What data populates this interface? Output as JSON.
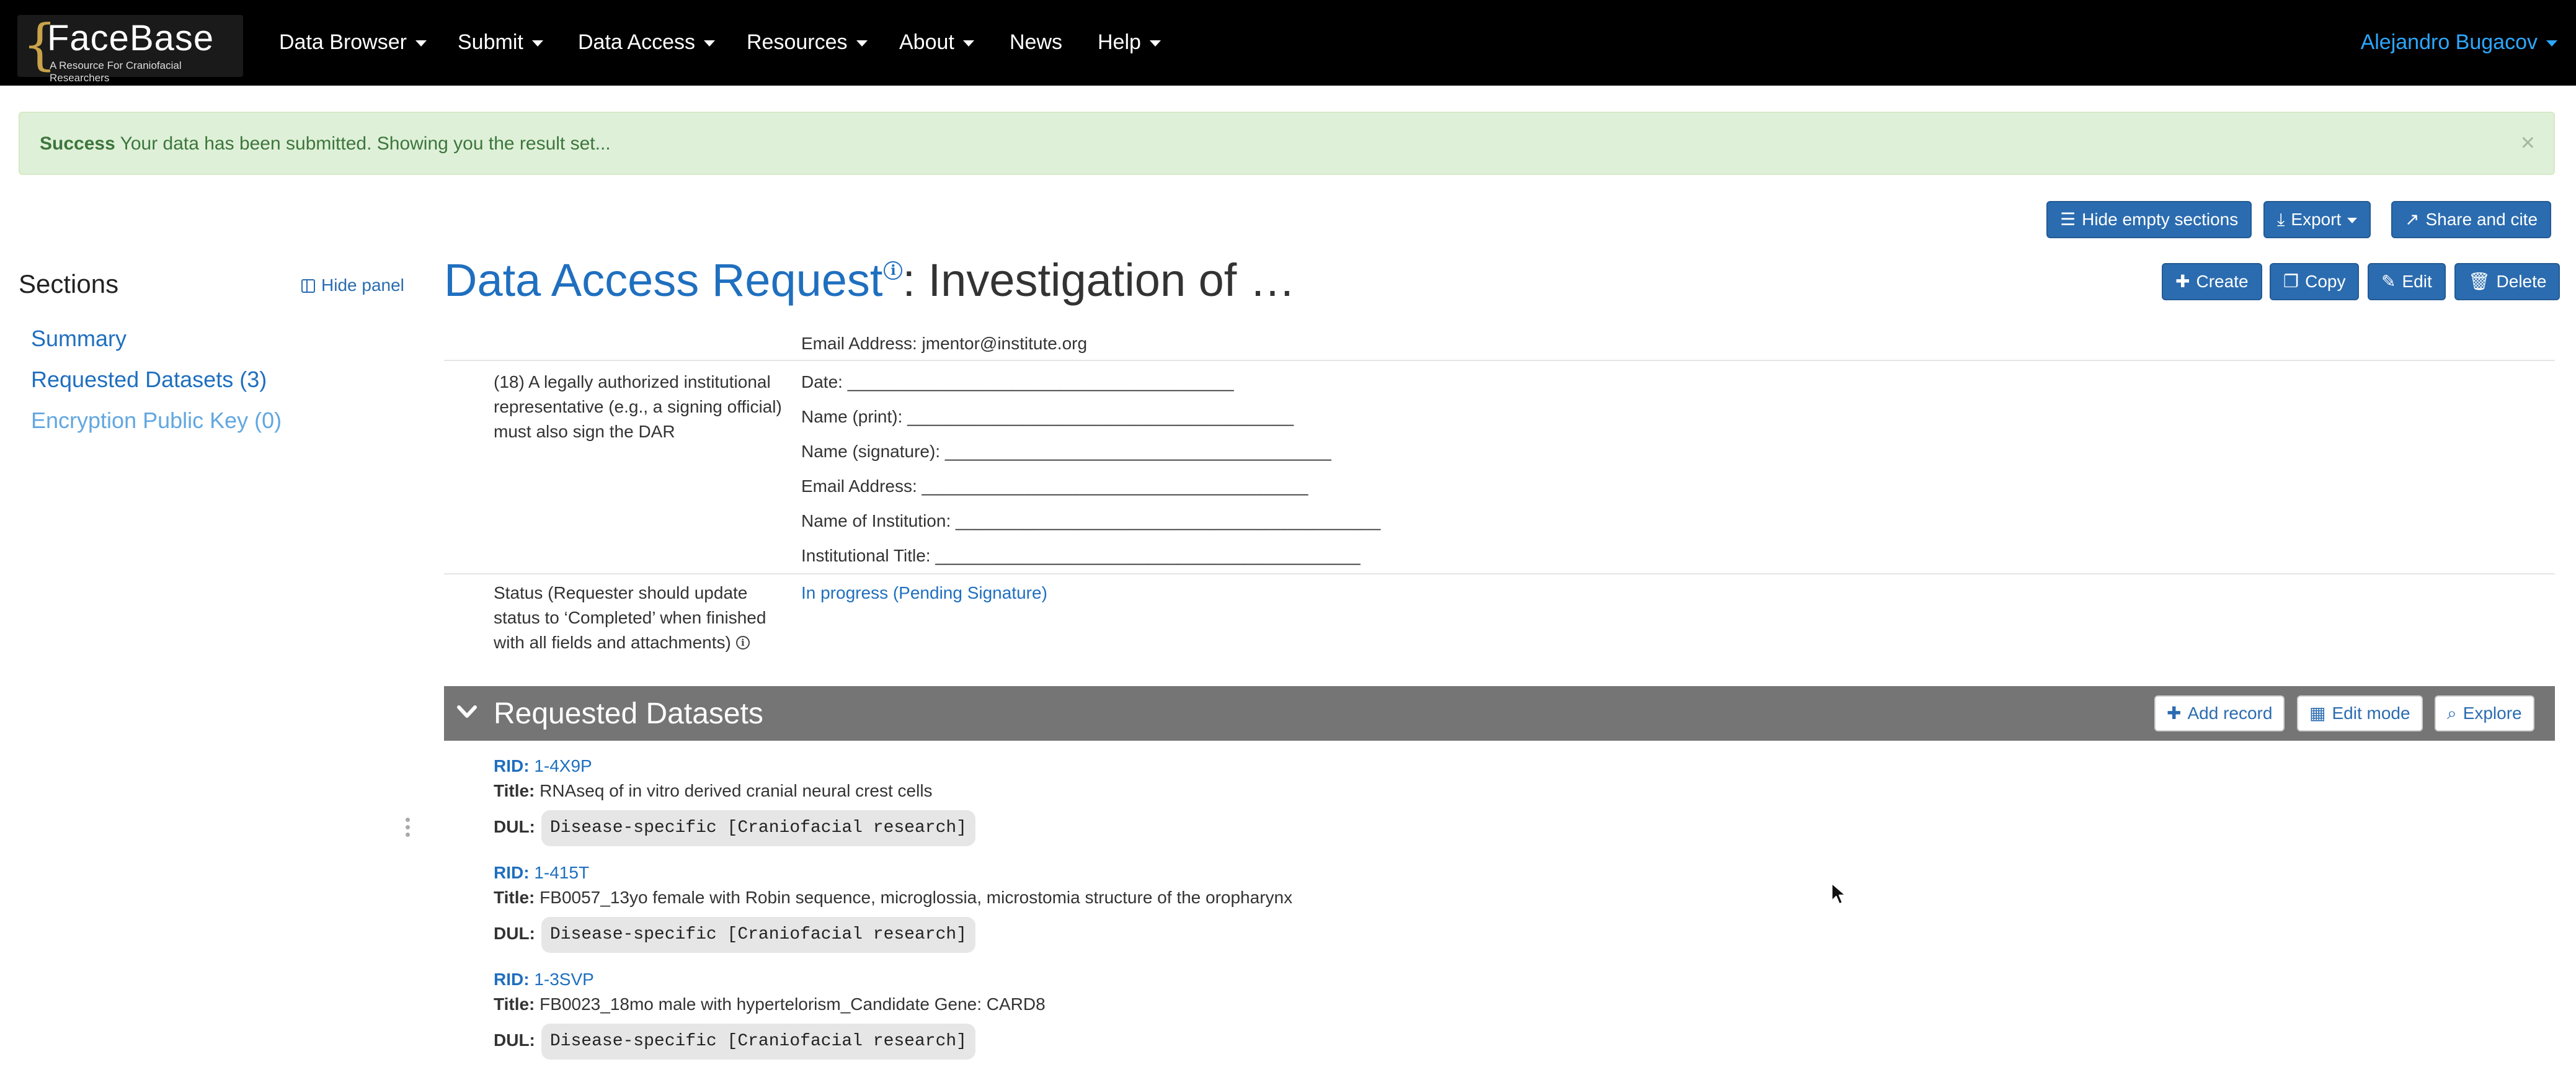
{
  "navbar": {
    "logo": {
      "name": "FaceBase",
      "tagline": "A Resource For Craniofacial Researchers"
    },
    "items": [
      {
        "label": "Data Browser",
        "dropdown": true
      },
      {
        "label": "Submit",
        "dropdown": true
      },
      {
        "label": "Data Access",
        "dropdown": true
      },
      {
        "label": "Resources",
        "dropdown": true
      },
      {
        "label": "About",
        "dropdown": true
      },
      {
        "label": "News",
        "dropdown": false
      },
      {
        "label": "Help",
        "dropdown": true
      }
    ],
    "user": "Alejandro Bugacov"
  },
  "alert": {
    "strong": "Success",
    "message": "Your data has been submitted. Showing you the result set...",
    "close": "×"
  },
  "toolbar": {
    "hide_empty": "Hide empty sections",
    "export": "Export",
    "share": "Share and cite"
  },
  "record_actions": {
    "create": "Create",
    "copy": "Copy",
    "edit": "Edit",
    "delete": "Delete"
  },
  "sidebar": {
    "title": "Sections",
    "hide_panel": "Hide panel",
    "links": [
      {
        "label": "Summary",
        "muted": false
      },
      {
        "label": "Requested Datasets (3)",
        "muted": false
      },
      {
        "label": "Encryption Public Key (0)",
        "muted": true
      }
    ]
  },
  "page": {
    "title_type": "Data Access Request",
    "title_info_icon": "i",
    "title_rest": ": Investigation of …"
  },
  "fields": {
    "email_value": "Email Address: jmentor@institute.org",
    "signing_label": "(18) A legally authorized institutional representative (e.g., a signing official) must also sign the DAR",
    "signing_lines": [
      "Date: ________________________________________",
      "Name (print): ________________________________________",
      "Name (signature): ________________________________________",
      "Email Address: ________________________________________",
      "Name of Institution: ____________________________________________",
      "Institutional Title: ____________________________________________"
    ],
    "status_label": "Status (Requester should update status to ‘Completed’ when finished with all fields and attachments)",
    "status_value": "In progress (Pending Signature)"
  },
  "requested_datasets": {
    "title": "Requested Datasets",
    "actions": {
      "add": "Add record",
      "edit_mode": "Edit mode",
      "explore": "Explore"
    },
    "rid_key": "RID:",
    "title_key": "Title:",
    "dul_key": "DUL:",
    "items": [
      {
        "rid": "1-4X9P",
        "title": "RNAseq of in vitro derived cranial neural crest cells",
        "dul": "Disease-specific [Craniofacial research]"
      },
      {
        "rid": "1-415T",
        "title": "FB0057_13yo female with Robin sequence, microglossia, microstomia structure of the oropharynx",
        "dul": "Disease-specific [Craniofacial research]"
      },
      {
        "rid": "1-3SVP",
        "title": "FB0023_18mo male with hypertelorism_Candidate Gene: CARD8",
        "dul": "Disease-specific [Craniofacial research]"
      }
    ]
  },
  "icons": {
    "list": "list-icon",
    "export": "export-icon",
    "share": "share-icon",
    "plus": "plus-icon",
    "copy": "copy-icon",
    "pencil": "pencil-icon",
    "trash": "trash-icon",
    "table": "table-icon",
    "search": "search-icon",
    "chevron": "chevron-down-icon"
  },
  "colors": {
    "navbar": "#000000",
    "brand_blue": "#1f6fbf",
    "button_blue": "#2b6cb0",
    "alert_bg": "#dff0d8",
    "alert_text": "#3c763d",
    "section_header": "#757575"
  }
}
